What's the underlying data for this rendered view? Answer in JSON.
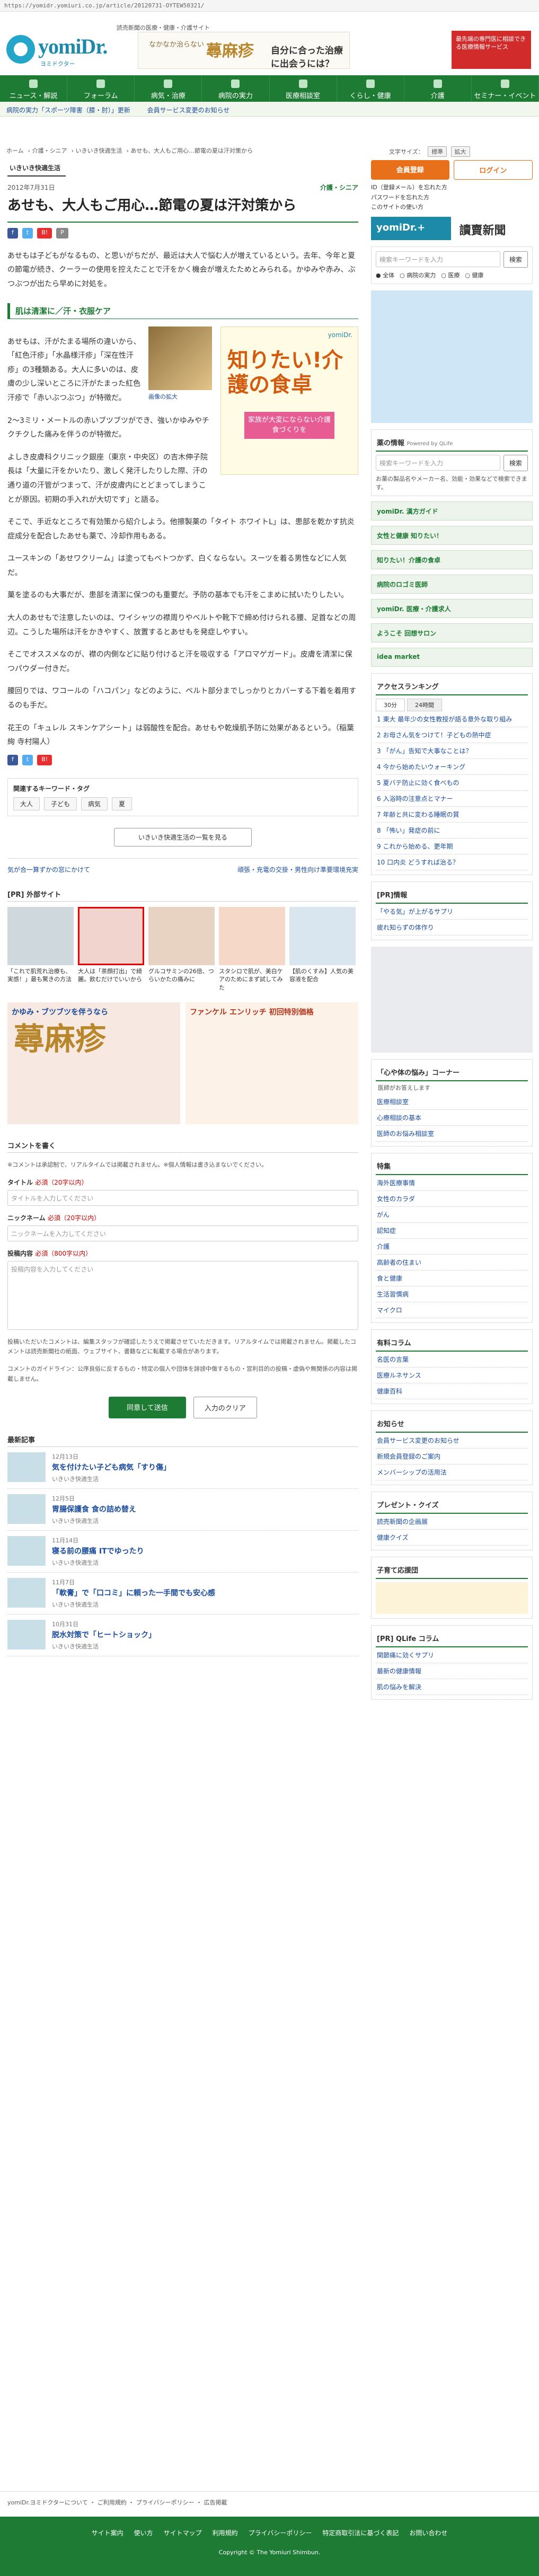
{
  "browser": {
    "url": "https://yomidr.yomiuri.co.jp/article/20120731-OYTEW50321/"
  },
  "header": {
    "tagline": "読売新聞の医療・健康・介護サイト",
    "logo": "yomiDr.",
    "logo_sub": "ヨミドクター",
    "ad1_left": "なかなか治らない",
    "ad1_center": "蕁麻疹",
    "ad1_right": "自分に合った治療に出会うには？",
    "ad2": "最先端の専門医に相談できる医療情報サービス"
  },
  "nav": [
    "ニュース・解説",
    "フォーラム",
    "病気・治療",
    "病院の実力",
    "医療相談室",
    "くらし・健康",
    "介護",
    "セミナー・イベント"
  ],
  "subnav": [
    "病院の実力「スポーツ障害（膝・肘）」更新",
    "会員サービス変更のお知らせ"
  ],
  "breadcrumb": [
    "ホーム",
    "介護・シニア",
    "いきいき快適生活",
    "あせも、大人もご用心…節電の夏は汗対策から"
  ],
  "textsize": {
    "label": "文字サイズ：",
    "std": "標準",
    "large": "拡大"
  },
  "article": {
    "category": "いきいき快適生活",
    "date": "2012年7月31日",
    "section": "介護・シニア",
    "title": "あせも、大人もご用心…節電の夏は汗対策から",
    "p1": "あせもは子どもがなるもの、と思いがちだが、最近は大人で悩む人が増えているという。去年、今年と夏の節電が続き、クーラーの使用を控えたことで汗をかく機会が増えたためとみられる。かゆみや赤み、ぶつぶつが出たら早めに対処を。",
    "h2": "肌は清潔に／汗・衣服ケア",
    "p2": "あせもは、汗がたまる場所の違いから、「紅色汗疹」「水晶様汗疹」「深在性汗疹」の3種類ある。大人に多いのは、皮膚の少し深いところに汗がたまった紅色汗疹で「赤いぶつぶつ」が特徴だ。",
    "p3": "2～3ミリ・メートルの赤いブツブツができ、強いかゆみやチクチクした痛みを伴うのが特徴だ。",
    "p4": "よしき皮膚科クリニック銀座（東京・中央区）の吉木伸子院長は「大量に汗をかいたり、激しく発汗したりした際、汗の通り道の汗管がつまって、汗が皮膚内にとどまってしまうことが原因。初期の手入れが大切です」と語る。",
    "p5": "そこで、手近なところで有効策から紹介しよう。他擦製薬の「タイト ホワイトL」は、患部を乾かす抗炎症成分を配合したあせも薬で、冷却作用もある。",
    "p6": "ユースキンの「あせワクリーム」は塗ってもベトつかず、白くならない。スーツを着る男性などに人気だ。",
    "p7": "菓を塗るのも大事だが、患部を清潔に保つのも重要だ。予防の基本でも汗をこまめに拭いたりしたい。",
    "p8": "大人のあせもで注意したいのは、ワイシャツの襟周りやベルトや靴下で締め付けられる腰、足首などの周辺。こうした場所は汗をかきやすく、放置するとあせもを発症しやすい。",
    "p9": "そこでオススメなのが、襟の内側などに貼り付けると汗を吸収する「アロマゲガード」。皮膚を清潔に保つパウダー付きだ。",
    "p10": "腰回りでは、ワコールの「ハコパン」などのように、ベルト部分までしっかりとカバーする下着を着用するのも手だ。",
    "p11": "花王の「キュレル スキンケアシート」は弱酸性を配合。あせもや乾燥肌予防に効果があるという。（稲葉絢 寺村陽人）",
    "img_link": "画像の拡大",
    "tags_label": "関連するキーワード・タグ",
    "tags": [
      "大人",
      "子ども",
      "病気",
      "夏"
    ],
    "more": "いきいき快適生活の一覧を見る",
    "prev": "気が合一算ずかの窓にかけて",
    "next": "頑張・充電の交掛・男性向け準要環境充実"
  },
  "banner": {
    "brand": "yomiDr.",
    "title": "知りたい!介護の食卓",
    "sub": "家族が大変にならない介護食づくりを"
  },
  "pr": {
    "label": "[PR] 外部サイト",
    "items": [
      {
        "text": "「これで肌荒れ治療も、実感！」最も驚きの方法"
      },
      {
        "text": "大人は「茶顔打出」で綺麗。飲むだけでいいから"
      },
      {
        "text": "グルコサミンの26倍、つらいかたの痛みに"
      },
      {
        "text": "スタシロで肌が、美白ケアのためにまず試してみた"
      },
      {
        "text": "【肌のくすみ】人気の美容液を配合"
      }
    ]
  },
  "ads": {
    "a1_title": "かゆみ・ブツブツを伴うなら",
    "a1_big": "蕁麻疹",
    "a2_title": "ファンケル エンリッチ 初回特別価格"
  },
  "comment": {
    "heading": "コメントを書く",
    "note": "※コメントは承認制で、リアルタイムでは掲載されません。※個人情報は書き込まないでください。",
    "title_label": "タイトル",
    "title_req": "必須（20字以内）",
    "title_ph": "タイトルを入力してください",
    "nick_label": "ニックネーム",
    "nick_req": "必須（20字以内）",
    "nick_ph": "ニックネームを入力してください",
    "body_label": "投稿内容",
    "body_req": "必須（800字以内）",
    "body_ph": "投稿内容を入力してください",
    "policy": "投稿いただいたコメントは、編集スタッフが確認したうえで掲載させていただきます。リアルタイムでは掲載されません。掲載したコメントは読売新聞社の紙面、ウェブサイト、書籍などに転載する場合があります。",
    "rules": "コメントのガイドライン：公序良俗に反するもの・特定の個人や団体を誹謗中傷するもの・営利目的の投稿・虚偽や無関係の内容は掲載しません。",
    "submit": "同意して送信",
    "clear": "入力のクリア"
  },
  "latest": {
    "heading": "最新記事",
    "items": [
      {
        "date": "12月13日",
        "title": "気を付けたい子ども病気「すり傷」",
        "sub": "いきいき快適生活"
      },
      {
        "date": "12月5日",
        "title": "胃腸保護食 食の詰め替え",
        "sub": "いきいき快適生活"
      },
      {
        "date": "11月14日",
        "title": "寝る前の腰痛 ITでゆったり",
        "sub": "いきいき快適生活"
      },
      {
        "date": "11月7日",
        "title": "「軟膏」で「口コミ」に頼った一手間でも安心感",
        "sub": "いきいき快適生活"
      },
      {
        "date": "10月31日",
        "title": "脱水対策で「ヒートショック」",
        "sub": "いきいき快適生活"
      }
    ]
  },
  "side": {
    "member": "会員登録",
    "login": "ログイン",
    "login_opts": [
      "ID（登録メール）を忘れた方",
      "パスワードを忘れた方",
      "このサイトの使い方"
    ],
    "yomidrplus": "yomiDr.+",
    "yomiuri": "讀賣新聞",
    "search_ph": "検索キーワードを入力",
    "search_btn": "検索",
    "radios": [
      "全体",
      "病院の実力",
      "医療",
      "健康"
    ],
    "qlife": "薬の情報",
    "qlife_by": "Powered by QLife",
    "drug_ph": "検索キーワードを入力",
    "drug_btn": "検索",
    "drug_note": "お薬の製品名やメーカー名、効能・効果などで検索できます。",
    "banners": [
      "yomiDr. 漢方ガイド",
      "女性と健康 知りたい！",
      "知りたい！介護の食卓",
      "病院のロゴミ医師",
      "yomiDr. 医療・介護求人",
      "ようこそ 回想サロン",
      "idea market"
    ],
    "ranking_h": "アクセスランキング",
    "ranking_tabs": [
      "30分",
      "24時間"
    ],
    "ranking": [
      "1 東大 最年少の女性教授が語る意外な取り組み",
      "2 お母さん気をつけて！子どもの熱中症",
      "3 「がん」告知で大事なことは？",
      "4 今から始めたいウォーキング",
      "5 夏バテ防止に効く食べもの",
      "6 入浴時の注意点とマナー",
      "7 年齢と共に変わる睡眠の質",
      "8 「怖い」発症の前に",
      "9 これから始める、更年期",
      "10 口内炎 どうすれば治る？"
    ],
    "pr_h": "[PR]情報",
    "pr_links": [
      "「やる気」が上がるサプリ",
      "疲れ知らずの体作り"
    ],
    "consult_h": "「心や体の悩み」コーナー",
    "consult_sub": "医師がお答えします",
    "consult_links": [
      "医療相談室",
      "心療相談の基本",
      "医師のお悩み相談室"
    ],
    "tokushu_h": "特集",
    "tokushu": [
      "海外医療事情",
      "女性のカラダ",
      "がん",
      "認知症",
      "介護",
      "高齢者の住まい",
      "食と健康",
      "生活習慣病",
      "マイクロ"
    ],
    "yuryo_h": "有料コラム",
    "yuryo": [
      "名医の言葉",
      "医療ルネサンス",
      "健康百科"
    ],
    "oshirase_h": "お知らせ",
    "oshirase": [
      "会員サービス変更のお知らせ",
      "新規会員登録のご案内",
      "メンバーシップの活用法"
    ],
    "present_h": "プレゼント・クイズ",
    "present": [
      "読売新聞の企画展",
      "健康クイズ"
    ],
    "kosodate_h": "子育て応援団",
    "qlife_pr_h": "[PR] QLife コラム",
    "qlife_pr": [
      "関節痛に効くサプリ",
      "最新の健康情報",
      "肌の悩みを解決"
    ]
  },
  "footer": {
    "pretop": "yomiDr.ヨミドクターについて ・ ご利用規約 ・ プライバシーポリシー ・ 広告掲載",
    "links": [
      "サイト案内",
      "使い方",
      "サイトマップ",
      "利用規約",
      "プライバシーポリシー",
      "特定商取引法に基づく表記",
      "お問い合わせ"
    ],
    "copyright": "Copyright © The Yomiuri Shimbun."
  }
}
